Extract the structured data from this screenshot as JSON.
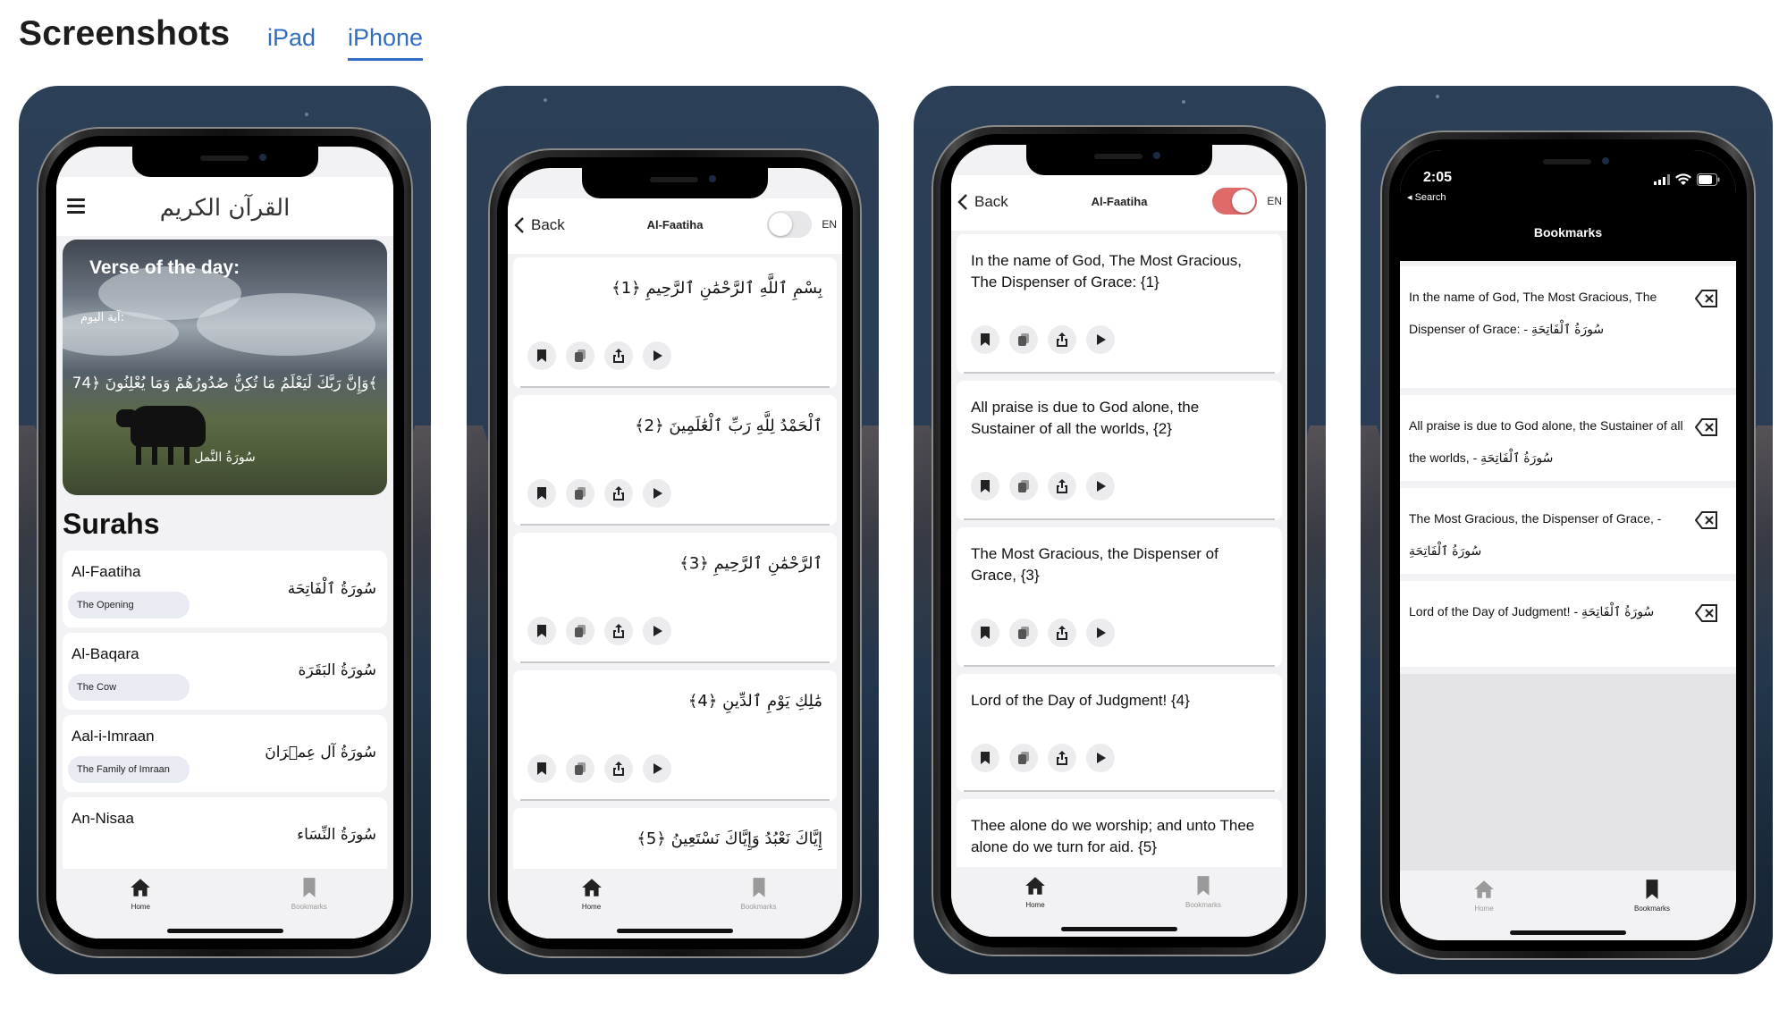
{
  "header": {
    "title": "Screenshots",
    "tabs": [
      {
        "label": "iPad",
        "selected": false
      },
      {
        "label": "iPhone",
        "selected": true
      }
    ],
    "accent_color": "#2f6ec4"
  },
  "tabbar": {
    "home_label": "Home",
    "bookmarks_label": "Bookmarks"
  },
  "screen1": {
    "logo": "القرآن الكريم",
    "verse_of_day": {
      "title": "Verse of the day:",
      "subtitle": "آية اليوم:",
      "ayah": "وَإِنَّ رَبَّكَ لَيَعْلَمُ مَا تُكِنُّ صُدُورُهُمْ وَمَا يُعْلِنُونَ ﴿74﴾",
      "surah": "سُورَةُ النَّمل"
    },
    "surahs_heading": "Surahs",
    "surahs": [
      {
        "name": "Al-Faatiha",
        "meaning": "The Opening",
        "arabic": "سُورَةُ ٱلْفَاتِحَة"
      },
      {
        "name": "Al-Baqara",
        "meaning": "The Cow",
        "arabic": "سُورَةُ البَقَرَة"
      },
      {
        "name": "Aal-i-Imraan",
        "meaning": "The Family of Imraan",
        "arabic": "سُورَةُ آل عِمۡرَانَ"
      },
      {
        "name": "An-Nisaa",
        "meaning": "",
        "arabic": "سُورَةُ النِّسَاء"
      }
    ]
  },
  "screen2": {
    "back_label": "Back",
    "title": "Al-Faatiha",
    "toggle_on": false,
    "lang_label": "EN",
    "verses": [
      "بِسْمِ ٱللَّهِ ٱلرَّحْمَٰنِ ٱلرَّحِيمِ ﴿1﴾",
      "ٱلْحَمْدُ لِلَّهِ رَبِّ ٱلْعَٰلَمِينَ ﴿2﴾",
      "ٱلرَّحْمَٰنِ ٱلرَّحِيمِ ﴿3﴾",
      "مَٰلِكِ يَوْمِ ٱلدِّينِ ﴿4﴾",
      "إِيَّاكَ نَعْبُدُ وَإِيَّاكَ نَسْتَعِينُ ﴿5﴾"
    ]
  },
  "screen3": {
    "back_label": "Back",
    "title": "Al-Faatiha",
    "toggle_on": true,
    "toggle_color": "#e06a6a",
    "lang_label": "EN",
    "verses": [
      "In the name of God, The Most Gracious, The Dispenser of Grace: {1}",
      "All praise is due to God alone, the Sustainer of all the worlds, {2}",
      "The Most Gracious, the Dispenser of Grace, {3}",
      "Lord of the Day of Judgment! {4}",
      "Thee alone do we worship; and unto Thee alone do we turn for aid. {5}"
    ]
  },
  "screen4": {
    "time": "2:05",
    "search_label": "◂ Search",
    "title": "Bookmarks",
    "bookmarks": [
      "In the name of God, The Most Gracious, The Dispenser of Grace: - سُورَةُ ٱلْفَاتِحَةِ",
      "All praise is due to God alone, the Sustainer of all the worlds, - سُورَةُ ٱلْفَاتِحَةِ",
      "The Most Gracious, the Dispenser of Grace, - سُورَةُ ٱلْفَاتِحَةِ",
      "Lord of the Day of Judgment! - سُورَةُ ٱلْفَاتِحَةِ"
    ]
  },
  "icons": [
    "menu-icon",
    "back-chevron-icon",
    "bookmark-icon",
    "copy-icon",
    "share-icon",
    "play-icon",
    "home-icon",
    "delete-icon",
    "signal-icon",
    "wifi-icon",
    "battery-icon"
  ]
}
